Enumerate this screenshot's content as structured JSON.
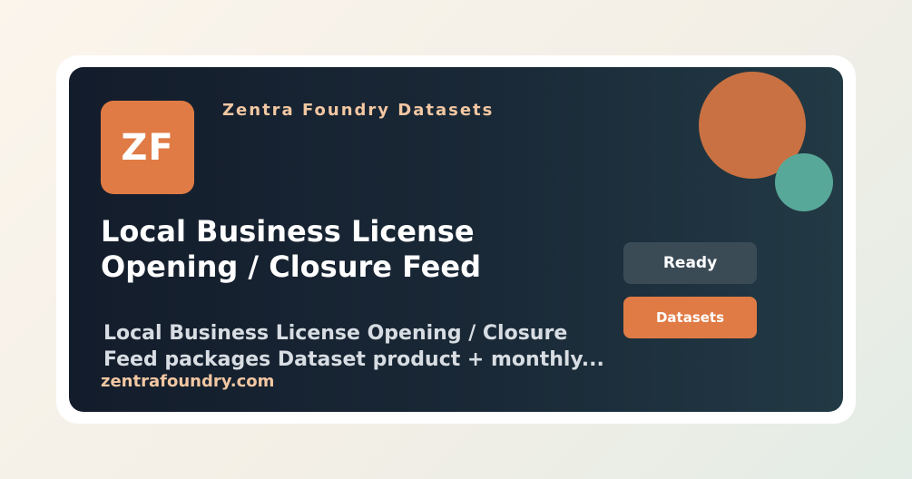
{
  "logo": {
    "initials": "ZF"
  },
  "brand": {
    "name": "Zentra Foundry Datasets",
    "url": "zentrafoundry.com"
  },
  "product": {
    "title_line1": "Local Business License",
    "title_line2": "Opening / Closure Feed",
    "description_line1": "Local Business License Opening / Closure",
    "description_line2": "Feed packages Dataset product + monthly..."
  },
  "actions": {
    "ready_label": "Ready",
    "datasets_label": "Datasets"
  },
  "colors": {
    "accent_orange": "#e07b45",
    "accent_teal": "#58a89a",
    "card_dark": "#131c2b",
    "brand_text": "#f2c7a2"
  }
}
